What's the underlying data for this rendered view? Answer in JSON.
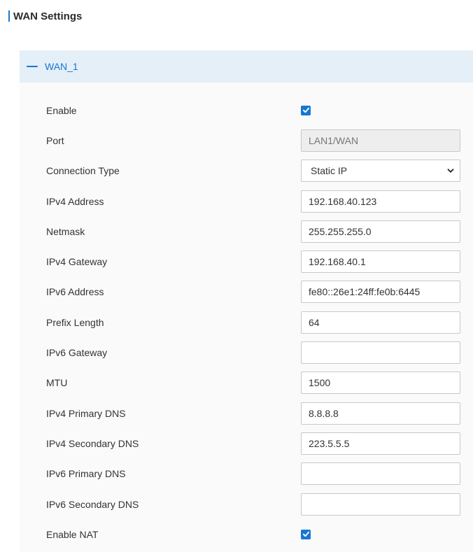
{
  "page": {
    "title": "WAN Settings"
  },
  "colors": {
    "accent": "#1677d2",
    "header_bg": "#e4eff8",
    "panel_bg": "#fafafa"
  },
  "panel": {
    "title": "WAN_1",
    "collapse_icon": "minus-icon"
  },
  "fields": {
    "enable": {
      "label": "Enable",
      "checked": true
    },
    "port": {
      "label": "Port",
      "value": "LAN1/WAN"
    },
    "connection_type": {
      "label": "Connection Type",
      "value": "Static IP",
      "icon": "chevron-down-icon"
    },
    "ipv4_address": {
      "label": "IPv4 Address",
      "value": "192.168.40.123"
    },
    "netmask": {
      "label": "Netmask",
      "value": "255.255.255.0"
    },
    "ipv4_gateway": {
      "label": "IPv4 Gateway",
      "value": "192.168.40.1"
    },
    "ipv6_address": {
      "label": "IPv6 Address",
      "value": "fe80::26e1:24ff:fe0b:6445"
    },
    "prefix_length": {
      "label": "Prefix Length",
      "value": "64"
    },
    "ipv6_gateway": {
      "label": "IPv6 Gateway",
      "value": ""
    },
    "mtu": {
      "label": "MTU",
      "value": "1500"
    },
    "ipv4_primary_dns": {
      "label": "IPv4 Primary DNS",
      "value": "8.8.8.8"
    },
    "ipv4_secondary_dns": {
      "label": "IPv4 Secondary DNS",
      "value": "223.5.5.5"
    },
    "ipv6_primary_dns": {
      "label": "IPv6 Primary DNS",
      "value": ""
    },
    "ipv6_secondary_dns": {
      "label": "IPv6 Secondary DNS",
      "value": ""
    },
    "enable_nat": {
      "label": "Enable NAT",
      "checked": true
    }
  }
}
